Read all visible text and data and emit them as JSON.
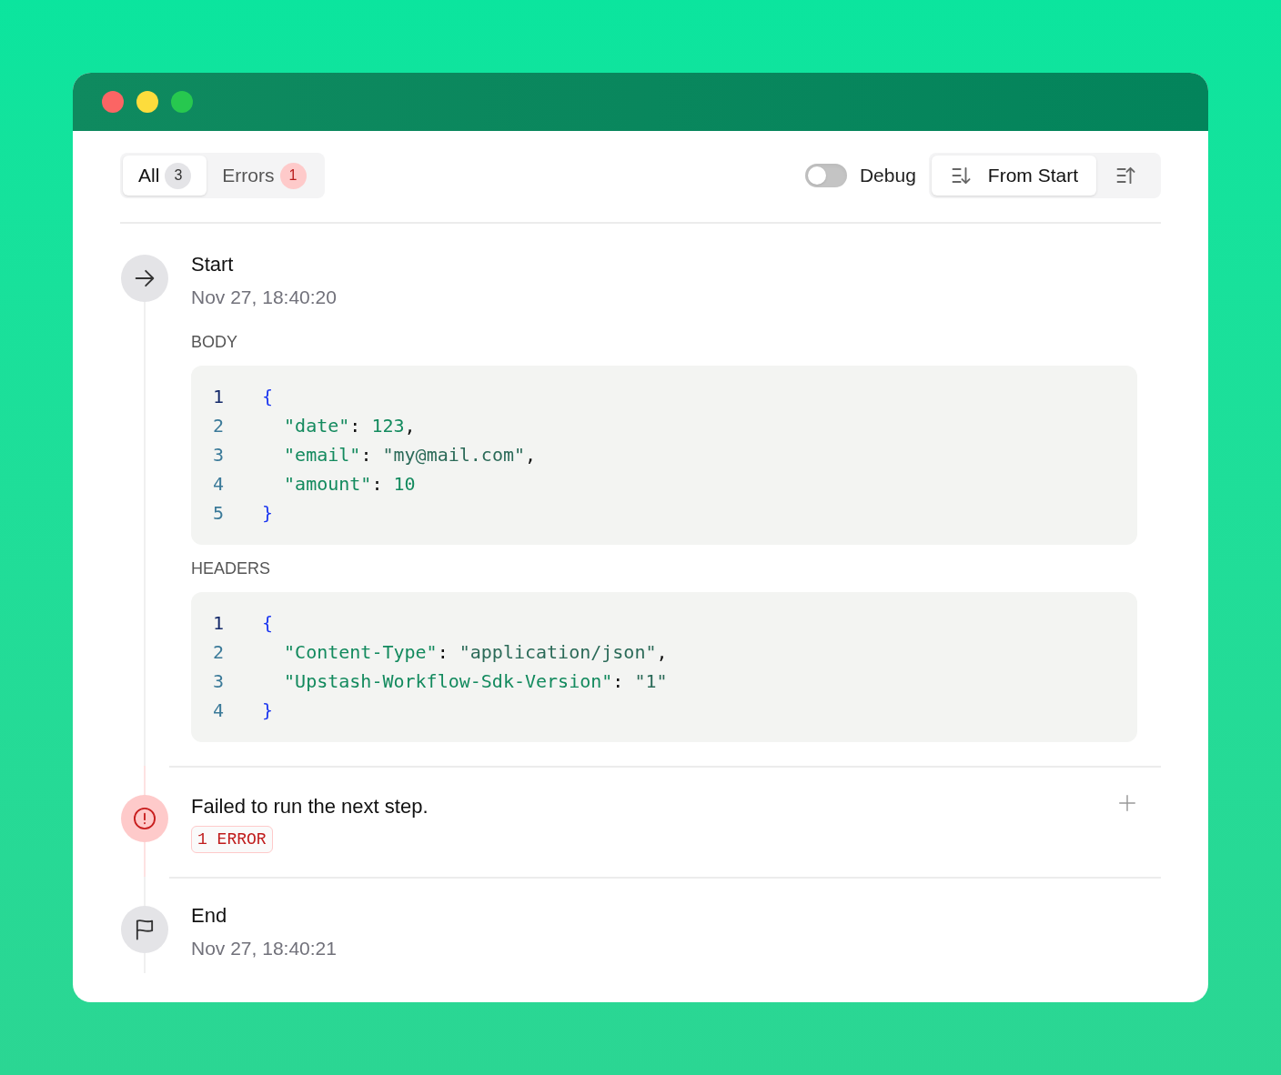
{
  "filters": [
    {
      "label": "All",
      "count": "3",
      "kind": "neutral",
      "selected": true
    },
    {
      "label": "Errors",
      "count": "1",
      "kind": "error",
      "selected": false
    }
  ],
  "debug": {
    "label": "Debug",
    "on": false
  },
  "sort": [
    {
      "label": "From Start",
      "kind": "descending",
      "selected": true
    },
    {
      "kind": "ascending",
      "selected": false
    }
  ],
  "steps": [
    {
      "kind": "start",
      "title": "Start",
      "time": "Nov 27, 18:40:20",
      "sections": [
        {
          "label": "BODY",
          "lines": [
            {
              "number": "1",
              "active": true,
              "tokens": [
                {
                  "kind": "brace",
                  "text": "{"
                }
              ]
            },
            {
              "number": "2",
              "active": false,
              "tokens": [
                {
                  "kind": "key",
                  "text": "  \"date\""
                },
                {
                  "kind": "punct",
                  "text": ": "
                },
                {
                  "kind": "number",
                  "text": "123"
                },
                {
                  "kind": "punct",
                  "text": ","
                }
              ]
            },
            {
              "number": "3",
              "active": false,
              "tokens": [
                {
                  "kind": "key",
                  "text": "  \"email\""
                },
                {
                  "kind": "punct",
                  "text": ": "
                },
                {
                  "kind": "string",
                  "text": "\"my@mail.com\""
                },
                {
                  "kind": "punct",
                  "text": ","
                }
              ]
            },
            {
              "number": "4",
              "active": false,
              "tokens": [
                {
                  "kind": "key",
                  "text": "  \"amount\""
                },
                {
                  "kind": "punct",
                  "text": ": "
                },
                {
                  "kind": "number",
                  "text": "10"
                }
              ]
            },
            {
              "number": "5",
              "active": false,
              "tokens": [
                {
                  "kind": "brace",
                  "text": "}"
                }
              ]
            }
          ]
        },
        {
          "label": "HEADERS",
          "lines": [
            {
              "number": "1",
              "active": true,
              "tokens": [
                {
                  "kind": "brace",
                  "text": "{"
                }
              ]
            },
            {
              "number": "2",
              "active": false,
              "tokens": [
                {
                  "kind": "key",
                  "text": "  \"Content-Type\""
                },
                {
                  "kind": "punct",
                  "text": ": "
                },
                {
                  "kind": "string",
                  "text": "\"application/json\""
                },
                {
                  "kind": "punct",
                  "text": ","
                }
              ]
            },
            {
              "number": "3",
              "active": false,
              "tokens": [
                {
                  "kind": "key",
                  "text": "  \"Upstash-Workflow-Sdk-Version\""
                },
                {
                  "kind": "punct",
                  "text": ": "
                },
                {
                  "kind": "string",
                  "text": "\"1\""
                }
              ]
            },
            {
              "number": "4",
              "active": false,
              "tokens": [
                {
                  "kind": "brace",
                  "text": "}"
                }
              ]
            }
          ]
        }
      ]
    },
    {
      "kind": "error",
      "title": "Failed to run the next step.",
      "badge": "1 ERROR",
      "expanded": false
    },
    {
      "kind": "end",
      "title": "End",
      "time": "Nov 27, 18:40:21"
    }
  ]
}
